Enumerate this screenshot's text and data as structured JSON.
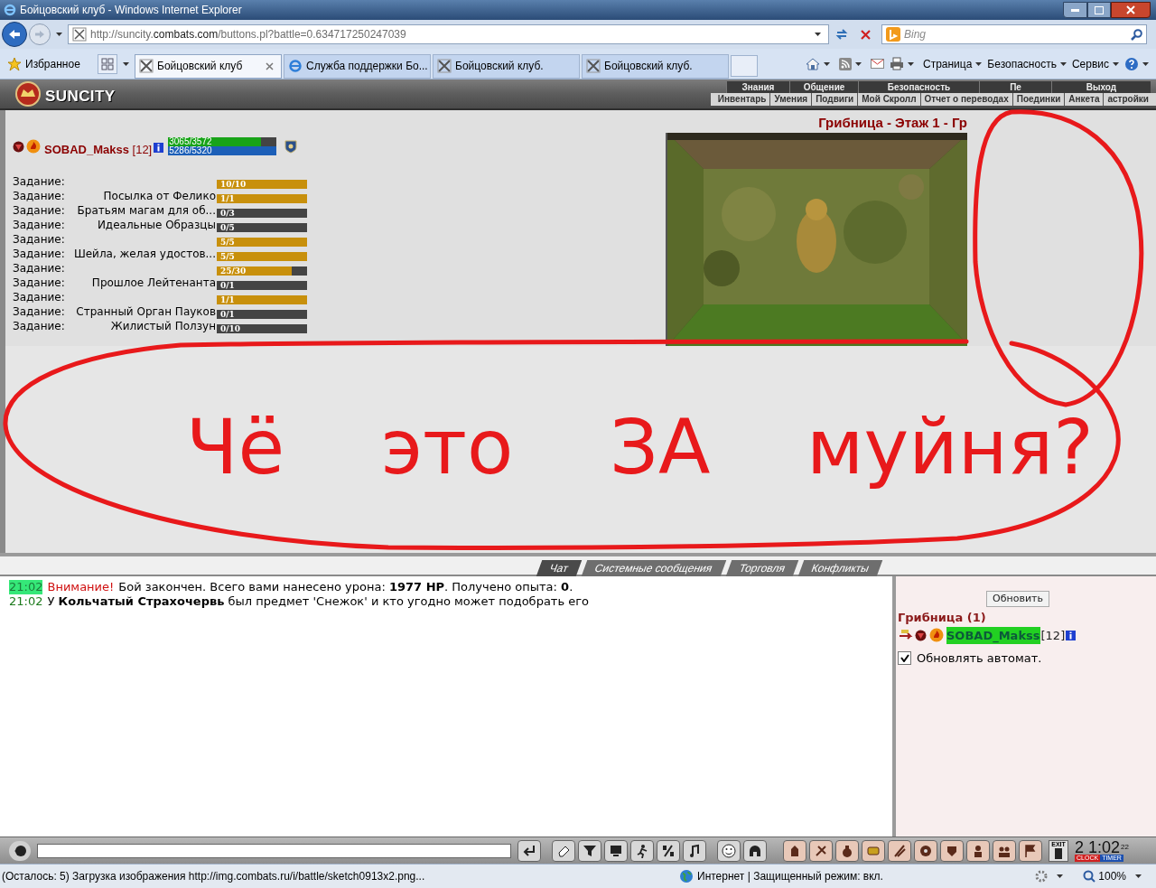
{
  "window": {
    "title": "Бойцовский клуб - Windows Internet Explorer"
  },
  "address_bar": {
    "url_start": "http://suncity.",
    "url_domain": "combats.com",
    "url_path": "/buttons.pl?battle=0.634717250247039"
  },
  "search": {
    "placeholder": "Bing"
  },
  "favorites": {
    "label": "Избранное"
  },
  "tabs": [
    {
      "label": "Бойцовский клуб",
      "selected": true,
      "kind": "swords"
    },
    {
      "label": "Служба поддержки Бо...",
      "selected": false,
      "kind": "browser"
    },
    {
      "label": "Бойцовский клуб.",
      "selected": false,
      "kind": "swords"
    },
    {
      "label": "Бойцовский клуб.",
      "selected": false,
      "kind": "swords"
    }
  ],
  "command_bar": [
    "Страница",
    "Безопасность",
    "Сервис"
  ],
  "game": {
    "logo": "SUNCITY",
    "menu_top": [
      "Знания",
      "Общение",
      "Безопасность",
      "Пе",
      "Выход"
    ],
    "menu_bottom": [
      "Инвентарь",
      "Умения",
      "Подвиги",
      "Мой Скролл",
      "Отчет о переводах",
      "Поединки",
      "Анкета",
      "астройки"
    ],
    "location": "Грибница - Этаж 1 - Гр",
    "player": {
      "name": "SOBAD_Makss",
      "level_text": "[12]",
      "hp": {
        "reading": "3065/3572",
        "level": 0.86
      },
      "mana": {
        "reading": "5286/5320",
        "level": 1
      }
    },
    "quests": [
      {
        "label": "Задание:",
        "progress": "10/10",
        "level": 1
      },
      {
        "label": "Задание:",
        "title": "Посылка от Фелико",
        "progress": "1/1",
        "level": 1
      },
      {
        "label": "Задание:",
        "title": "Братьям магам для об...",
        "progress": "0/3",
        "level": 0
      },
      {
        "label": "Задание:",
        "title": "Идеальные Образцы",
        "progress": "0/5",
        "level": 0
      },
      {
        "label": "Задание:",
        "progress": "5/5",
        "level": 1
      },
      {
        "label": "Задание:",
        "title": "Шейла, желая удостов...",
        "progress": "5/5",
        "level": 1
      },
      {
        "label": "Задание:",
        "progress": "25/30",
        "level": 0.833
      },
      {
        "label": "Задание:",
        "title": "Прошлое Лейтенанта",
        "progress": "0/1",
        "level": 0
      },
      {
        "label": "Задание:",
        "progress": "1/1",
        "level": 1
      },
      {
        "label": "Задание:",
        "title": "Странный Орган Пауков",
        "progress": "0/1",
        "level": 0
      },
      {
        "label": "Задание:",
        "title": "Жилистый Ползун",
        "progress": "0/10",
        "level": 0
      }
    ]
  },
  "annotation": {
    "text": "Чё это ЗА муйня?"
  },
  "chat": {
    "tabs": [
      {
        "label": "Чат",
        "selected": true
      },
      {
        "label": "Системные сообщения",
        "selected": false
      },
      {
        "label": "Торговля",
        "selected": false
      },
      {
        "label": "Конфликты",
        "selected": false
      }
    ],
    "messages": [
      {
        "time": "21:02",
        "time_highlighted": true,
        "alert": "Внимание!",
        "text": "Бой закончен. Всего вами нанесено урона: **1977 HP**. Получено опыта: **0**."
      },
      {
        "time": "21:02",
        "time_highlighted": false,
        "text": "У **Кольчатый Страхочервь** был предмет 'Снежок' и кто угодно может подобрать его"
      }
    ]
  },
  "room_panel": {
    "refresh_button": "Обновить",
    "title": "Грибница (1)",
    "users": [
      {
        "name": "SOBAD_Makss",
        "level_text": "[12]",
        "selected": true
      }
    ],
    "auto_refresh": {
      "label": "Обновлять автомат.",
      "checked": true
    }
  },
  "chat_toolbar": {
    "exit_label": "EXIT",
    "time": "2 1:02",
    "seconds": "22",
    "clock_label": "CLOCK",
    "timer_label": "TIMER"
  },
  "status_bar": {
    "text": "(Осталось: 5) Загрузка изображения http://img.combats.ru/i/battle/sketch0913x2.png...",
    "zone": "Интернет | Защищенный режим: вкл.",
    "zoom": "100%"
  }
}
